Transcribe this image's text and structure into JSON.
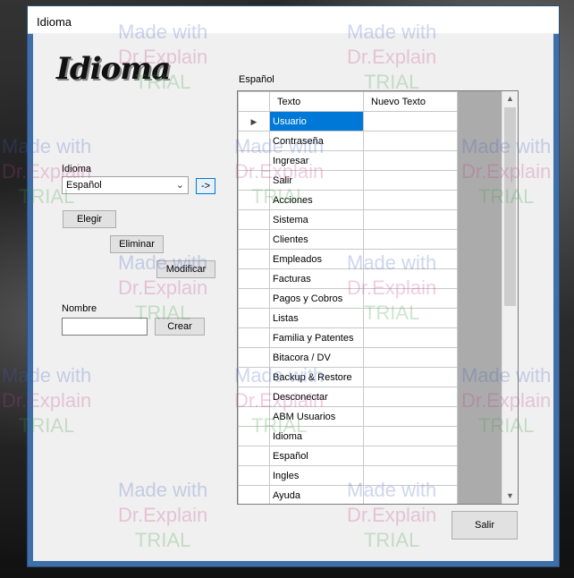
{
  "window": {
    "title": "Idioma"
  },
  "logo": {
    "text": "Idioma"
  },
  "language_panel": {
    "label": "Idioma",
    "selected": "Español",
    "go_button": "->",
    "elegir_button": "Elegir",
    "eliminar_button": "Eliminar",
    "modificar_button": "Modificar"
  },
  "create_panel": {
    "label": "Nombre",
    "value": "",
    "crear_button": "Crear"
  },
  "grid": {
    "caption": "Español",
    "columns": [
      "Texto",
      "Nuevo Texto"
    ],
    "rows": [
      "Usuario",
      "Contraseña",
      "Ingresar",
      "Salir",
      "Acciones",
      "Sistema",
      "Clientes",
      "Empleados",
      "Facturas",
      "Pagos y Cobros",
      "Listas",
      "Familia y Patentes",
      "Bitacora / DV",
      "Backup & Restore",
      "Desconectar",
      "ABM Usuarios",
      "Idioma",
      "Español",
      "Ingles",
      "Ayuda"
    ],
    "selected_row": 0
  },
  "salir_button": "Salir",
  "watermark": {
    "line1": "Made with",
    "line2": "Dr.Explain",
    "line3": "TRIAL"
  }
}
